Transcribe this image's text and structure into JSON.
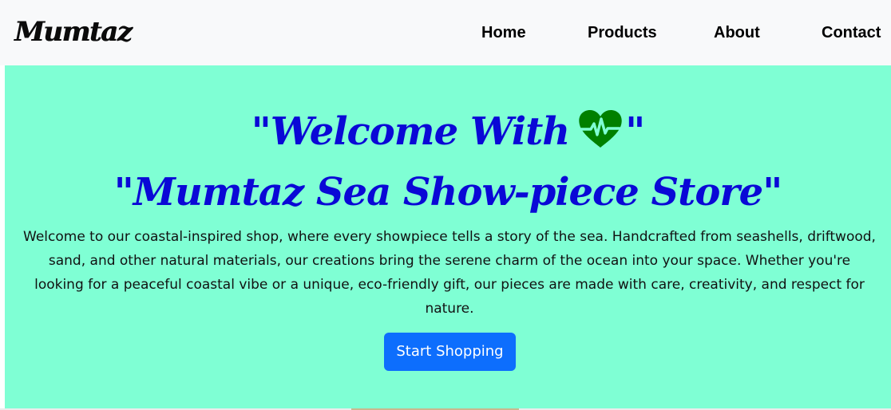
{
  "navbar": {
    "brand": "Mumtaz",
    "links": [
      {
        "label": "Home"
      },
      {
        "label": "Products"
      },
      {
        "label": "About"
      },
      {
        "label": "Contact"
      }
    ]
  },
  "hero": {
    "title_line1": "\"Welcome With",
    "title_icon": "heart-pulse-icon",
    "title_line1_end": "\"",
    "title_line2": "\"Mumtaz Sea Show-piece Store\"",
    "intro": "Welcome to our coastal-inspired shop, where every showpiece tells a story of the sea. Handcrafted from seashells, driftwood, sand, and other natural materials, our creations bring the serene charm of the ocean into your space. Whether you're looking for a peaceful coastal vibe or a unique, eco-friendly gift, our pieces are made with care, creativity, and respect for nature.",
    "button_label": "Start Shopping"
  },
  "colors": {
    "hero_background": "#7fffd4",
    "title_color": "#0a08d6",
    "heart_color": "#008000",
    "button_color": "#0d6efd",
    "navbar_background": "#f8f9fa"
  }
}
